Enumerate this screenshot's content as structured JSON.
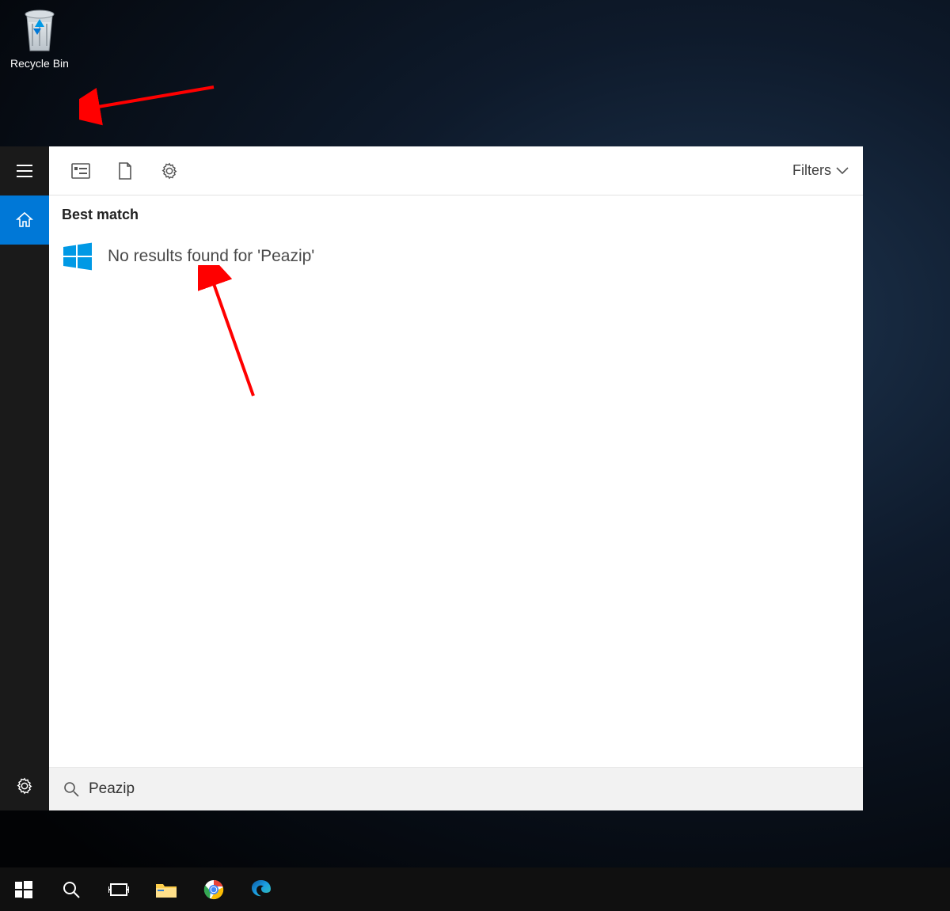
{
  "desktop": {
    "recycle_bin_label": "Recycle Bin"
  },
  "search": {
    "section_label": "Best match",
    "no_results_text": "No results found for 'Peazip'",
    "filters_label": "Filters",
    "query": "Peazip"
  }
}
